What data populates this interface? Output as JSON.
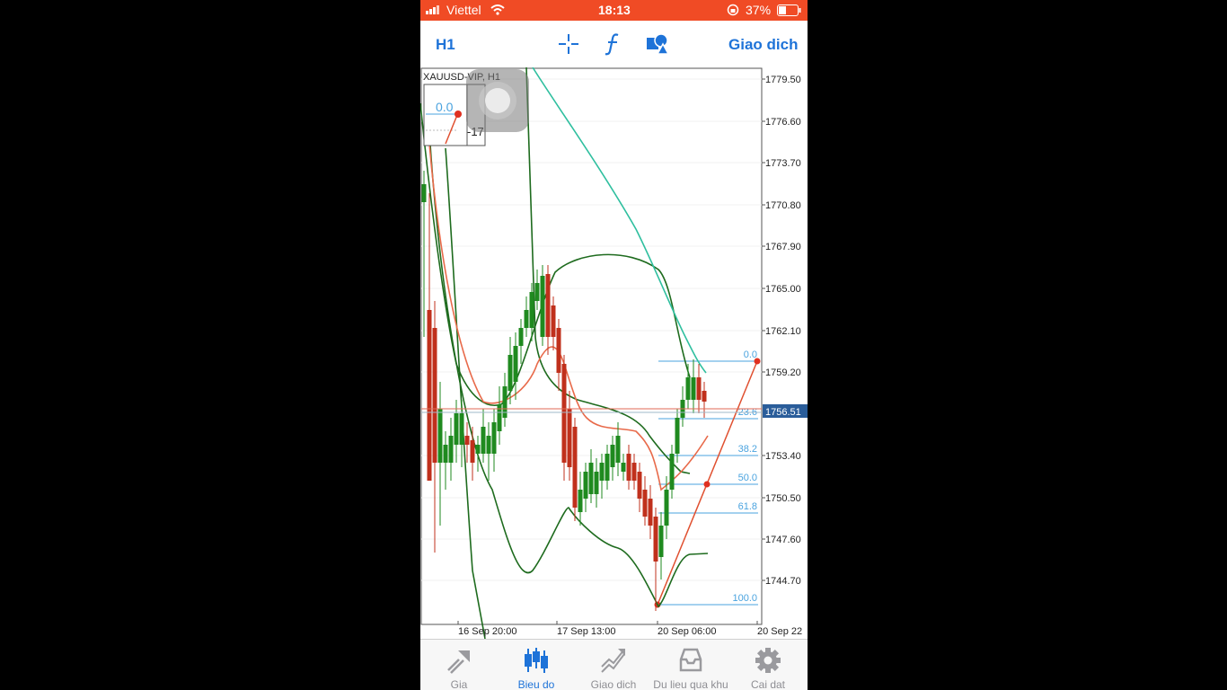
{
  "status_bar": {
    "carrier": "Viettel",
    "time": "18:13",
    "battery": "37%"
  },
  "toolbar": {
    "timeframe": "H1",
    "crosshair_icon": "crosshair-icon",
    "indicators_icon": "function-icon",
    "objects_icon": "shapes-icon",
    "trade_label": "Giao dich"
  },
  "chart": {
    "symbol_label": "XAUUSD-VIP, H1",
    "inset_value": "0.0",
    "inset_side": "-17",
    "current_price_label": "1756.51",
    "price_levels": [
      "1779.50",
      "1776.60",
      "1773.70",
      "1770.80",
      "1767.90",
      "1765.00",
      "1762.10",
      "1759.20",
      "1753.40",
      "1750.50",
      "1747.60",
      "1744.70"
    ],
    "time_labels": [
      "16 Sep 20:00",
      "17 Sep 13:00",
      "20 Sep 06:00",
      "20 Sep 22"
    ],
    "fib_levels": [
      "0.0",
      "23.6",
      "38.2",
      "50.0",
      "61.8",
      "100.0"
    ]
  },
  "chart_data": {
    "type": "candlestick",
    "symbol": "XAUUSD-VIP",
    "timeframe": "H1",
    "ylim": [
      1742.0,
      1781.0
    ],
    "current_price": 1756.51,
    "fibonacci": {
      "high": 1759.6,
      "low": 1743.7,
      "levels": [
        0.0,
        23.6,
        38.2,
        50.0,
        61.8,
        100.0
      ]
    }
  },
  "tabs": [
    {
      "label": "Gia",
      "icon": "quotes-icon"
    },
    {
      "label": "Bieu do",
      "icon": "chart-icon"
    },
    {
      "label": "Giao dich",
      "icon": "trade-icon"
    },
    {
      "label": "Du lieu qua khu",
      "icon": "history-icon"
    },
    {
      "label": "Cai dat",
      "icon": "settings-icon"
    }
  ],
  "colors": {
    "accent": "#1e73d8",
    "status_bar": "#f04b25",
    "bull": "#1f8a1f",
    "bear": "#c0301c",
    "band": "#1e6b1e",
    "ma_fast": "#e86a4a",
    "ma_slow": "#2fbf9f",
    "fib": "#4aa3df"
  }
}
